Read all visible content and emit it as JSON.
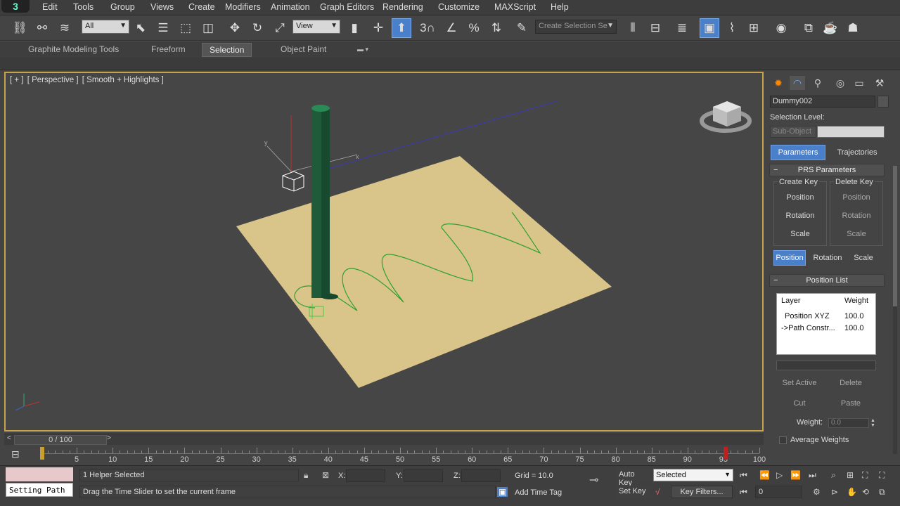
{
  "app": {
    "logo": "3"
  },
  "menu": [
    "Edit",
    "Tools",
    "Group",
    "Views",
    "Create",
    "Modifiers",
    "Animation",
    "Graph Editors",
    "Rendering",
    "Customize",
    "MAXScript",
    "Help"
  ],
  "toolbar": {
    "filter_value": "All",
    "refcoord_value": "View",
    "selection_set_placeholder": "Create Selection Se",
    "snap_label": "3"
  },
  "ribbon": {
    "tabs": [
      "Graphite Modeling Tools",
      "Freeform",
      "Selection",
      "Object Paint"
    ],
    "active_tab": "Selection"
  },
  "viewport": {
    "label_plus": "[ + ]",
    "label_view": "[ Perspective ]",
    "label_shading": "[ Smooth + Highlights ]",
    "axis_x": "x",
    "axis_y": "y"
  },
  "command_panel": {
    "object_name": "Dummy002",
    "selection_level_label": "Selection Level:",
    "sub_object": "Sub-Object",
    "tabs": {
      "parameters": "Parameters",
      "trajectories": "Trajectories"
    },
    "prs_rollout": "PRS Parameters",
    "create_key_title": "Create Key",
    "delete_key_title": "Delete Key",
    "create_keys": [
      "Position",
      "Rotation",
      "Scale"
    ],
    "delete_keys": [
      "Position",
      "Rotation",
      "Scale"
    ],
    "mode_buttons": [
      "Position",
      "Rotation",
      "Scale"
    ],
    "active_mode": "Position",
    "position_list_rollout": "Position List",
    "list_headers": {
      "layer": "Layer",
      "weight": "Weight"
    },
    "list_rows": [
      {
        "layer": "Position XYZ",
        "weight": "100.0"
      },
      {
        "layer": "->Path Constr...",
        "weight": "100.0"
      }
    ],
    "set_active": "Set Active",
    "delete": "Delete",
    "cut": "Cut",
    "paste": "Paste",
    "weight_label": "Weight:",
    "weight_value": "0.0",
    "average_weights": "Average Weights"
  },
  "timeline": {
    "frame_display": "0 / 100",
    "ticks": [
      "5",
      "10",
      "15",
      "20",
      "25",
      "30",
      "35",
      "40",
      "45",
      "50",
      "55",
      "60",
      "65",
      "70",
      "75",
      "80",
      "85",
      "90",
      "95",
      "100"
    ]
  },
  "status": {
    "maxscript_text": "Setting Path",
    "selected_count": "1 Helper Selected",
    "prompt": "Drag the Time Slider to set the current frame",
    "x_label": "X:",
    "y_label": "Y:",
    "z_label": "Z:",
    "grid": "Grid = 10.0",
    "add_time_tag": "Add Time Tag",
    "auto_key": "Auto Key",
    "set_key": "Set Key",
    "selected_dd": "Selected",
    "key_filters": "Key Filters...",
    "frame_field": "0"
  }
}
